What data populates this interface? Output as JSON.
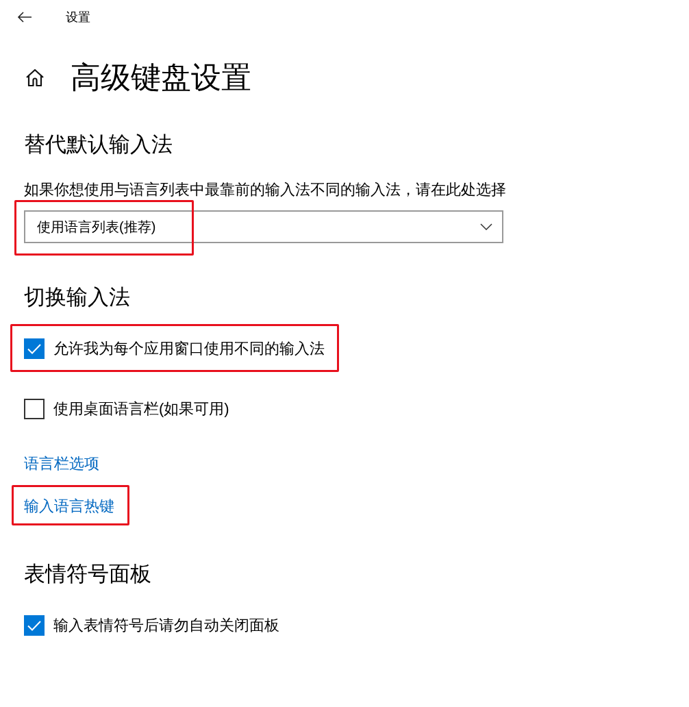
{
  "header": {
    "title": "设置"
  },
  "page": {
    "title": "高级键盘设置"
  },
  "sections": [
    {
      "heading": "替代默认输入法",
      "items": [
        {
          "kind": "description",
          "text": "如果你想使用与语言列表中最靠前的输入法不同的输入法，请在此处选择"
        },
        {
          "kind": "dropdown",
          "value": "使用语言列表(推荐)",
          "highlighted": true
        }
      ]
    },
    {
      "heading": "切换输入法",
      "items": [
        {
          "kind": "checkbox",
          "label": "允许我为每个应用窗口使用不同的输入法",
          "checked": true,
          "highlighted": true
        },
        {
          "kind": "checkbox",
          "label": "使用桌面语言栏(如果可用)",
          "checked": false,
          "highlighted": false
        },
        {
          "kind": "link",
          "label": "语言栏选项",
          "highlighted": false
        },
        {
          "kind": "link",
          "label": "输入语言热键",
          "highlighted": true
        }
      ]
    },
    {
      "heading": "表情符号面板",
      "items": [
        {
          "kind": "checkbox",
          "label": "输入表情符号后请勿自动关闭面板",
          "checked": true,
          "highlighted": false
        }
      ]
    }
  ]
}
